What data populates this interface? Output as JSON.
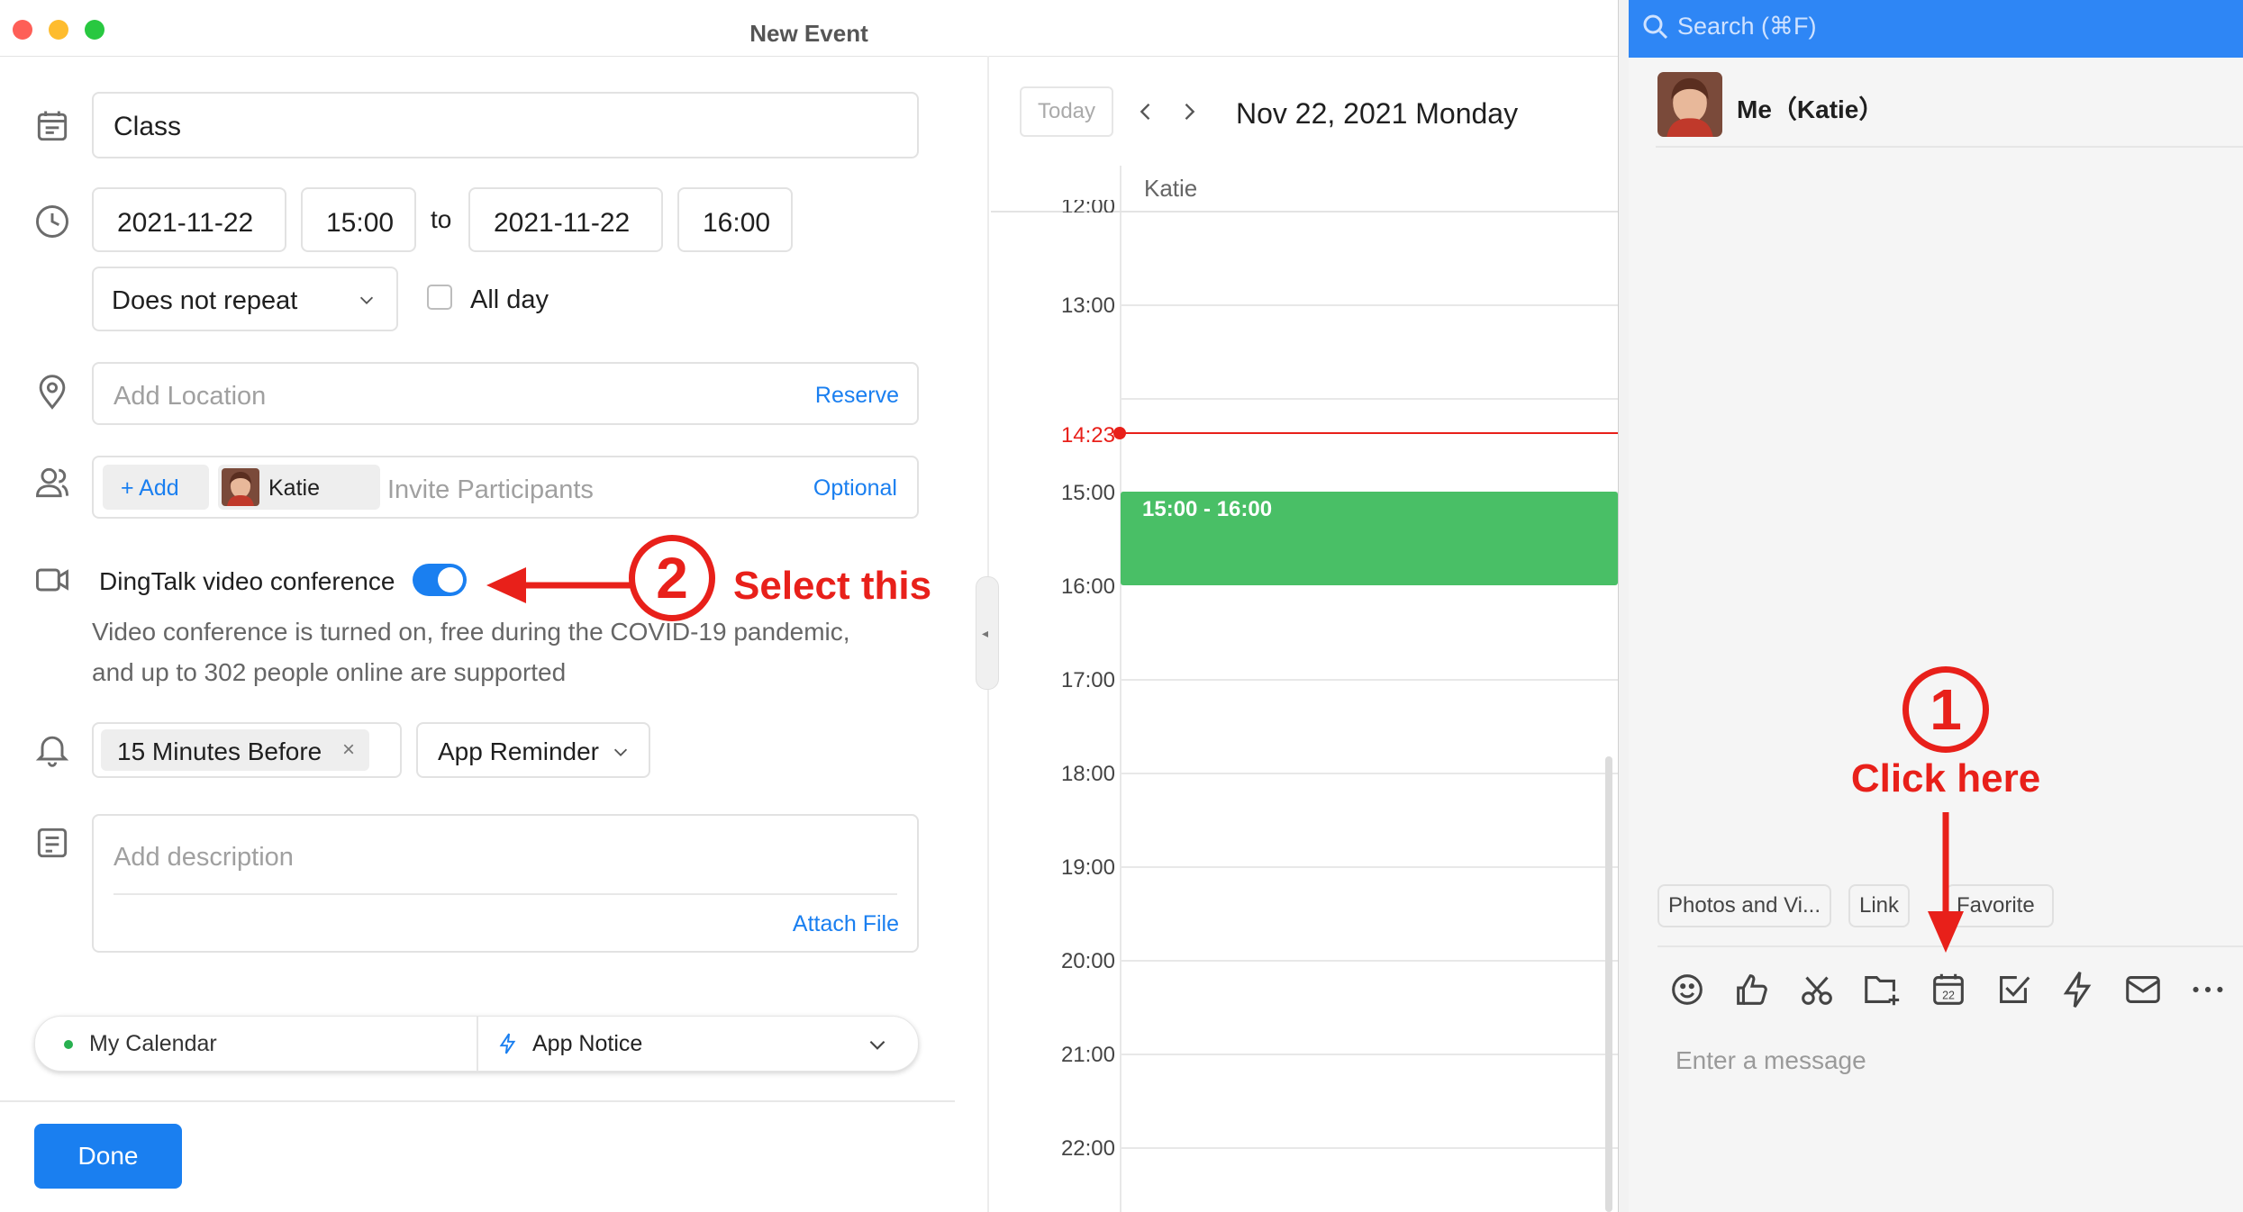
{
  "window": {
    "title": "New Event"
  },
  "form": {
    "title_value": "Class",
    "start_date": "2021-11-22",
    "start_time": "15:00",
    "to_label": "to",
    "end_date": "2021-11-22",
    "end_time": "16:00",
    "repeat_value": "Does not repeat",
    "allday_label": "All day",
    "location_placeholder": "Add Location",
    "reserve_label": "Reserve",
    "add_label": "+ Add",
    "participant_name": "Katie",
    "invite_placeholder": "Invite Participants",
    "optional_label": "Optional",
    "video_label": "DingTalk video conference",
    "video_desc_line1": "Video conference is turned on, free during the COVID-19 pandemic,",
    "video_desc_line2": "and up to 302 people online are supported",
    "reminder_chip": "15 Minutes Before",
    "reminder_chip_close": "×",
    "reminder_type": "App Reminder",
    "description_placeholder": "Add description",
    "attach_label": "Attach File",
    "calendar_label": "My Calendar",
    "notice_label": "App Notice",
    "done_label": "Done",
    "video_toggle_on": true
  },
  "calendar": {
    "today_label": "Today",
    "date_title": "Nov 22, 2021 Monday",
    "attendee": "Katie",
    "hours": [
      "12:00",
      "13:00",
      "15:00",
      "16:00",
      "17:00",
      "18:00",
      "19:00",
      "20:00",
      "21:00",
      "22:00"
    ],
    "now_time": "14:23",
    "event_time": "15:00 - 16:00",
    "event_color": "#49bf66",
    "now_color": "#e8201a"
  },
  "chat": {
    "search_placeholder": "Search (⌘F)",
    "contact_name": "Me（Katie）",
    "chips": [
      "Photos and Vi...",
      "Link",
      "Favorite"
    ],
    "calendar_icon_day": "22",
    "message_placeholder": "Enter a message",
    "tools": [
      "emoji-icon",
      "thumbs-up-icon",
      "scissors-icon",
      "folder-add-icon",
      "calendar-icon",
      "checkbox-icon",
      "lightning-icon",
      "mail-icon",
      "more-icon"
    ]
  },
  "annotations": {
    "step1_number": "1",
    "step1_text": "Click here",
    "step2_number": "2",
    "step2_text": "Select this",
    "color": "#e8201a"
  },
  "colors": {
    "accent": "#1a7ff0",
    "header_blue": "#2e86f5"
  }
}
